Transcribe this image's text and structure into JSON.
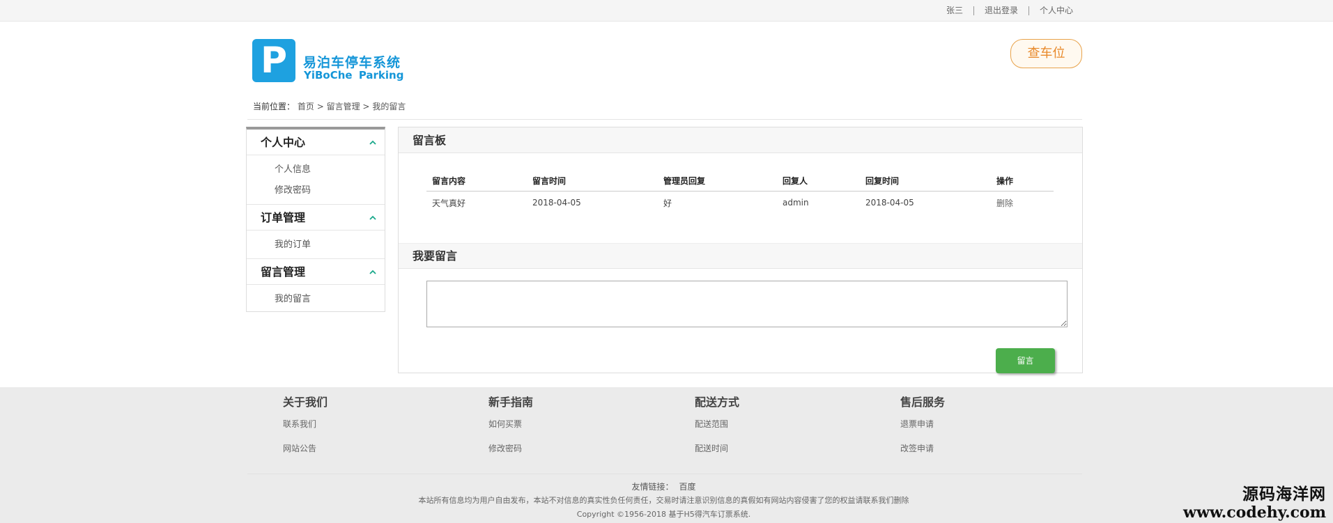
{
  "topbar": {
    "username": "张三",
    "logout": "退出登录",
    "user_center": "个人中心"
  },
  "header": {
    "logo_letter": "P",
    "brand_cn": "易泊车停车系统",
    "brand_en": "YiBoChe Parking",
    "find_spot_button": "查车位"
  },
  "breadcrumb": {
    "label": "当前位置：",
    "items": [
      "首页",
      "留言管理",
      "我的留言"
    ],
    "sep": ">"
  },
  "sidebar": {
    "groups": [
      {
        "title": "个人中心",
        "items": [
          "个人信息",
          "修改密码"
        ]
      },
      {
        "title": "订单管理",
        "items": [
          "我的订单"
        ]
      },
      {
        "title": "留言管理",
        "items": [
          "我的留言"
        ]
      }
    ],
    "chevron_icon": "chevron-up-icon"
  },
  "board": {
    "title": "留言板",
    "columns": [
      "留言内容",
      "留言时间",
      "管理员回复",
      "回复人",
      "回复时间",
      "操作"
    ],
    "rows": [
      [
        "天气真好",
        "2018-04-05",
        "好",
        "admin",
        "2018-04-05",
        "删除"
      ]
    ]
  },
  "compose": {
    "title": "我要留言",
    "textarea_value": "",
    "submit_label": "留言"
  },
  "footer": {
    "columns": [
      {
        "title": "关于我们",
        "links": [
          "联系我们",
          "网站公告"
        ]
      },
      {
        "title": "新手指南",
        "links": [
          "如何买票",
          "修改密码"
        ]
      },
      {
        "title": "配送方式",
        "links": [
          "配送范围",
          "配送时间"
        ]
      },
      {
        "title": "售后服务",
        "links": [
          "退票申请",
          "改签申请"
        ]
      }
    ],
    "friend_label": "友情链接：",
    "friend_link": "百度",
    "notice": "本站所有信息均为用户自由发布，本站不对信息的真实性负任何责任，交易时请注意识别信息的真假如有网站内容侵害了您的权益请联系我们删除",
    "copyright": "Copyright ©1956-2018 基于H5得汽车订票系统."
  },
  "watermark": {
    "line1": "源码海洋网",
    "line2": "www.codehy.com"
  },
  "colors": {
    "brand_blue": "#1ea1e0",
    "accent_green": "#4cae4c",
    "find_button_orange": "#e8892a"
  }
}
